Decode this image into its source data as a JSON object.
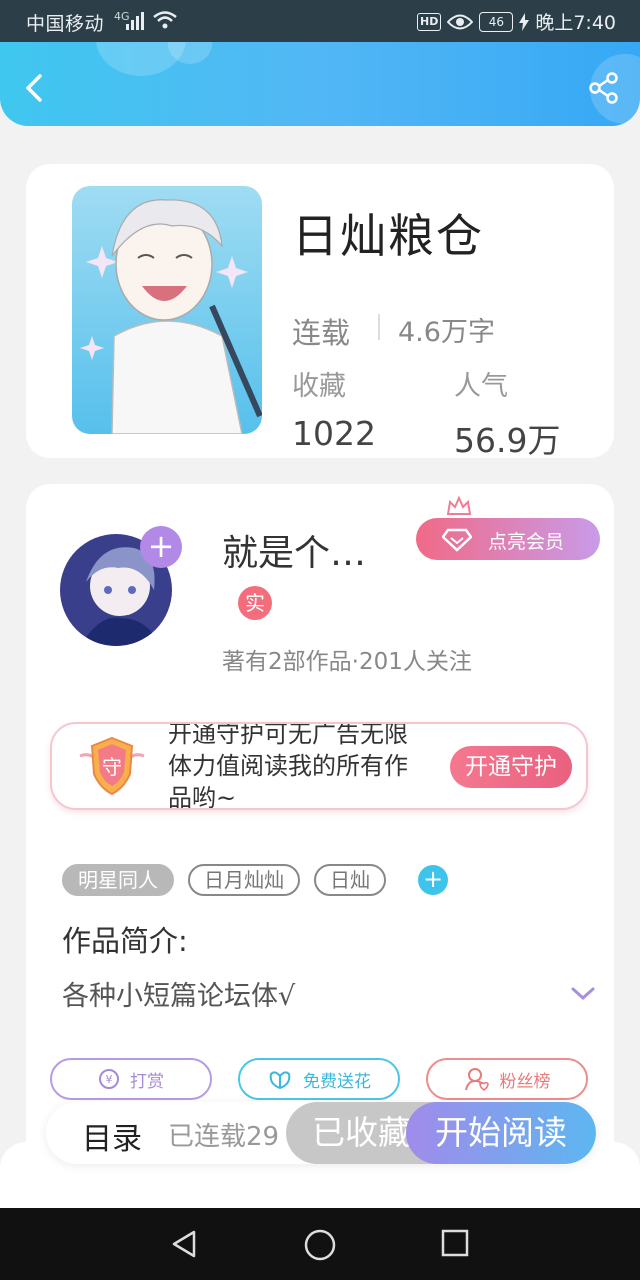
{
  "status_bar": {
    "carrier": "中国移动",
    "network": "4G",
    "hd": "HD",
    "battery": "46",
    "time": "晚上7:40"
  },
  "header": {
    "back_icon": "back-chevron-icon",
    "share_icon": "share-icon"
  },
  "book": {
    "title": "日灿粮仓",
    "status": "连载",
    "words": "4.6万字",
    "fav_label": "收藏",
    "fav_value": "1022",
    "pop_label": "人气",
    "pop_value": "56.9万"
  },
  "author": {
    "name": "就是个…",
    "real_badge": "实",
    "stats": "著有2部作品·201人关注",
    "follow_icon": "plus-icon",
    "vip_label": "点亮会员"
  },
  "guard": {
    "shield_text": "守",
    "text": "开通守护可无广告无限体力值阅读我的所有作品哟~",
    "button": "开通守护"
  },
  "tags": [
    "明星同人",
    "日月灿灿",
    "日灿"
  ],
  "intro": {
    "title": "作品简介:",
    "text": "各种小短篇论坛体√"
  },
  "actions": {
    "tip": "打赏",
    "flower": "免费送花",
    "fans": "粉丝榜"
  },
  "bottom_bar": {
    "toc": "目录",
    "serial": "已连载29",
    "fav_button": "已收藏",
    "read_button": "开始阅读"
  },
  "colors": {
    "header_start": "#3fc7ef",
    "header_end": "#36a8f5",
    "vip_start": "#f06a87",
    "vip_end": "#c99be9",
    "read_start": "#a18bea",
    "read_end": "#5cb7f0"
  }
}
